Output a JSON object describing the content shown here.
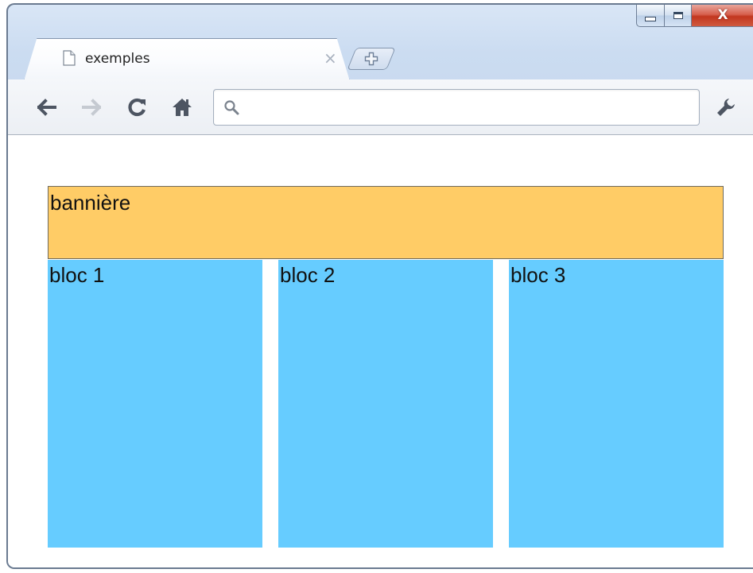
{
  "window": {
    "controls": {
      "minimize": "–",
      "maximize": "□",
      "close": "X"
    }
  },
  "tabs": [
    {
      "title": "exemples",
      "close": "×",
      "active": true
    }
  ],
  "new_tab": {
    "icon": "plus-icon"
  },
  "toolbar": {
    "back": "back-arrow-icon",
    "forward": "forward-arrow-icon",
    "reload": "reload-icon",
    "home": "home-icon",
    "omnibox": {
      "value": "",
      "placeholder": ""
    },
    "settings": "wrench-icon"
  },
  "page": {
    "banner": {
      "label": "bannière",
      "color": "#ffcc66"
    },
    "blocks": [
      {
        "label": "bloc 1",
        "color": "#66ccff"
      },
      {
        "label": "bloc 2",
        "color": "#66ccff"
      },
      {
        "label": "bloc 3",
        "color": "#66ccff"
      }
    ]
  }
}
